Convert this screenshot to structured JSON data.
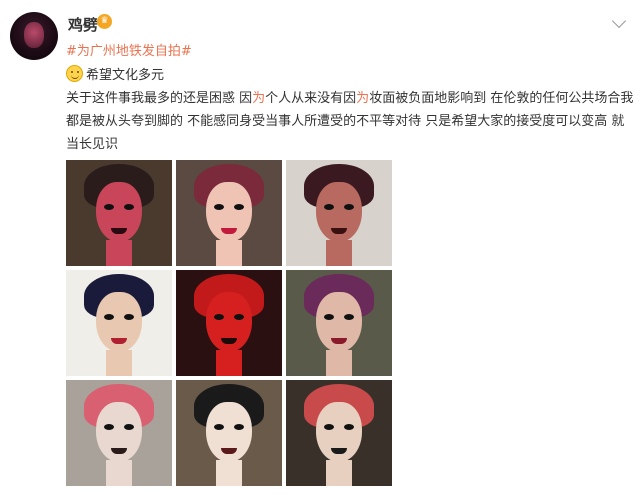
{
  "post": {
    "username": "鸡劈",
    "vip_icon": "crown-badge-icon",
    "topic": "#为广州地铁发自拍#",
    "line1": "希望文化多元",
    "para_a": "关于这件事我最多的还是困惑 因",
    "para_b": "为",
    "para_c": "个人从来没有因",
    "para_d": "为",
    "para_e": "妆面被负面地影响到 在伦敦的任何公共场合我都是被从头夸到脚的 不能感同身受当事人所遭受的不平等对待 只是希望大家的接受度可以变高 就当长见识",
    "photos": [
      {
        "bg": "#4a3a2e",
        "hair": "#2a1c1a",
        "face": "#c8455a",
        "mouth": "#2a0a10"
      },
      {
        "bg": "#5a4a42",
        "hair": "#7a2a3a",
        "face": "#f0c4b4",
        "mouth": "#c21a3a"
      },
      {
        "bg": "#d8d2cc",
        "hair": "#3a1a20",
        "face": "#b86a60",
        "mouth": "#3a1010"
      },
      {
        "bg": "#f0eee8",
        "hair": "#1a1a3a",
        "face": "#e8c8b0",
        "mouth": "#b02030"
      },
      {
        "bg": "#2a1010",
        "hair": "#c21a1a",
        "face": "#d62020",
        "mouth": "#1a0a0a"
      },
      {
        "bg": "#5a5a4a",
        "hair": "#6a2a5a",
        "face": "#e0b8a8",
        "mouth": "#8a1a2a"
      },
      {
        "bg": "#a8a29a",
        "hair": "#d86070",
        "face": "#e8d8d0",
        "mouth": "#2a1a1a"
      },
      {
        "bg": "#6a5a4a",
        "hair": "#1a1a1a",
        "face": "#f0e0d4",
        "mouth": "#5a1a1a"
      },
      {
        "bg": "#3a302a",
        "hair": "#c84a4a",
        "face": "#e8d0c0",
        "mouth": "#1a1a1a"
      }
    ]
  }
}
